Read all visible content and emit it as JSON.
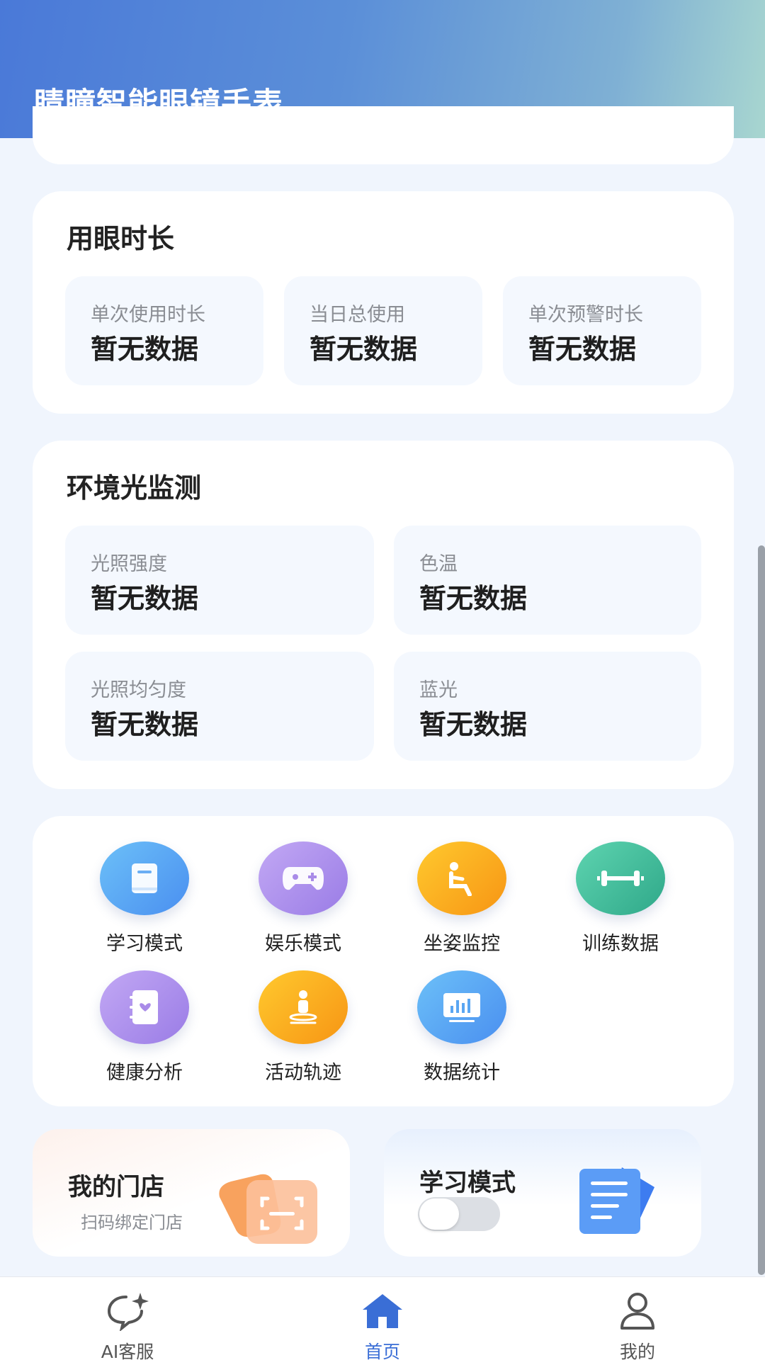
{
  "header": {
    "title": "睛瞳智能眼镜手表"
  },
  "eye_usage": {
    "title": "用眼时长",
    "stats": [
      {
        "label": "单次使用时长",
        "value": "暂无数据"
      },
      {
        "label": "当日总使用",
        "value": "暂无数据"
      },
      {
        "label": "单次预警时长",
        "value": "暂无数据"
      }
    ]
  },
  "ambient_light": {
    "title": "环境光监测",
    "stats": [
      {
        "label": "光照强度",
        "value": "暂无数据"
      },
      {
        "label": "色温",
        "value": "暂无数据"
      },
      {
        "label": "光照均匀度",
        "value": "暂无数据"
      },
      {
        "label": "蓝光",
        "value": "暂无数据"
      }
    ]
  },
  "functions": [
    {
      "label": "学习模式",
      "icon": "book-icon",
      "color": "#5aa6f2"
    },
    {
      "label": "娱乐模式",
      "icon": "gamepad-icon",
      "color": "#a98be8"
    },
    {
      "label": "坐姿监控",
      "icon": "seated-person-icon",
      "color": "#f6a41a"
    },
    {
      "label": "训练数据",
      "icon": "dumbbell-icon",
      "color": "#3fbf9a"
    },
    {
      "label": "健康分析",
      "icon": "health-notebook-icon",
      "color": "#a98be8"
    },
    {
      "label": "活动轨迹",
      "icon": "activity-person-icon",
      "color": "#f6a41a"
    },
    {
      "label": "数据统计",
      "icon": "bar-chart-icon",
      "color": "#5aa6f2"
    }
  ],
  "store_card": {
    "title": "我的门店",
    "subtitle": "扫码绑定门店"
  },
  "study_card": {
    "title": "学习模式",
    "toggle_on": false
  },
  "tabbar": [
    {
      "label": "AI客服",
      "icon": "chat-sparkle-icon",
      "active": false
    },
    {
      "label": "首页",
      "icon": "home-icon",
      "active": true
    },
    {
      "label": "我的",
      "icon": "user-icon",
      "active": false
    }
  ],
  "colors": {
    "accent": "#3a6ed6",
    "header_start": "#4a79d8",
    "header_end": "#a8d6d0"
  }
}
